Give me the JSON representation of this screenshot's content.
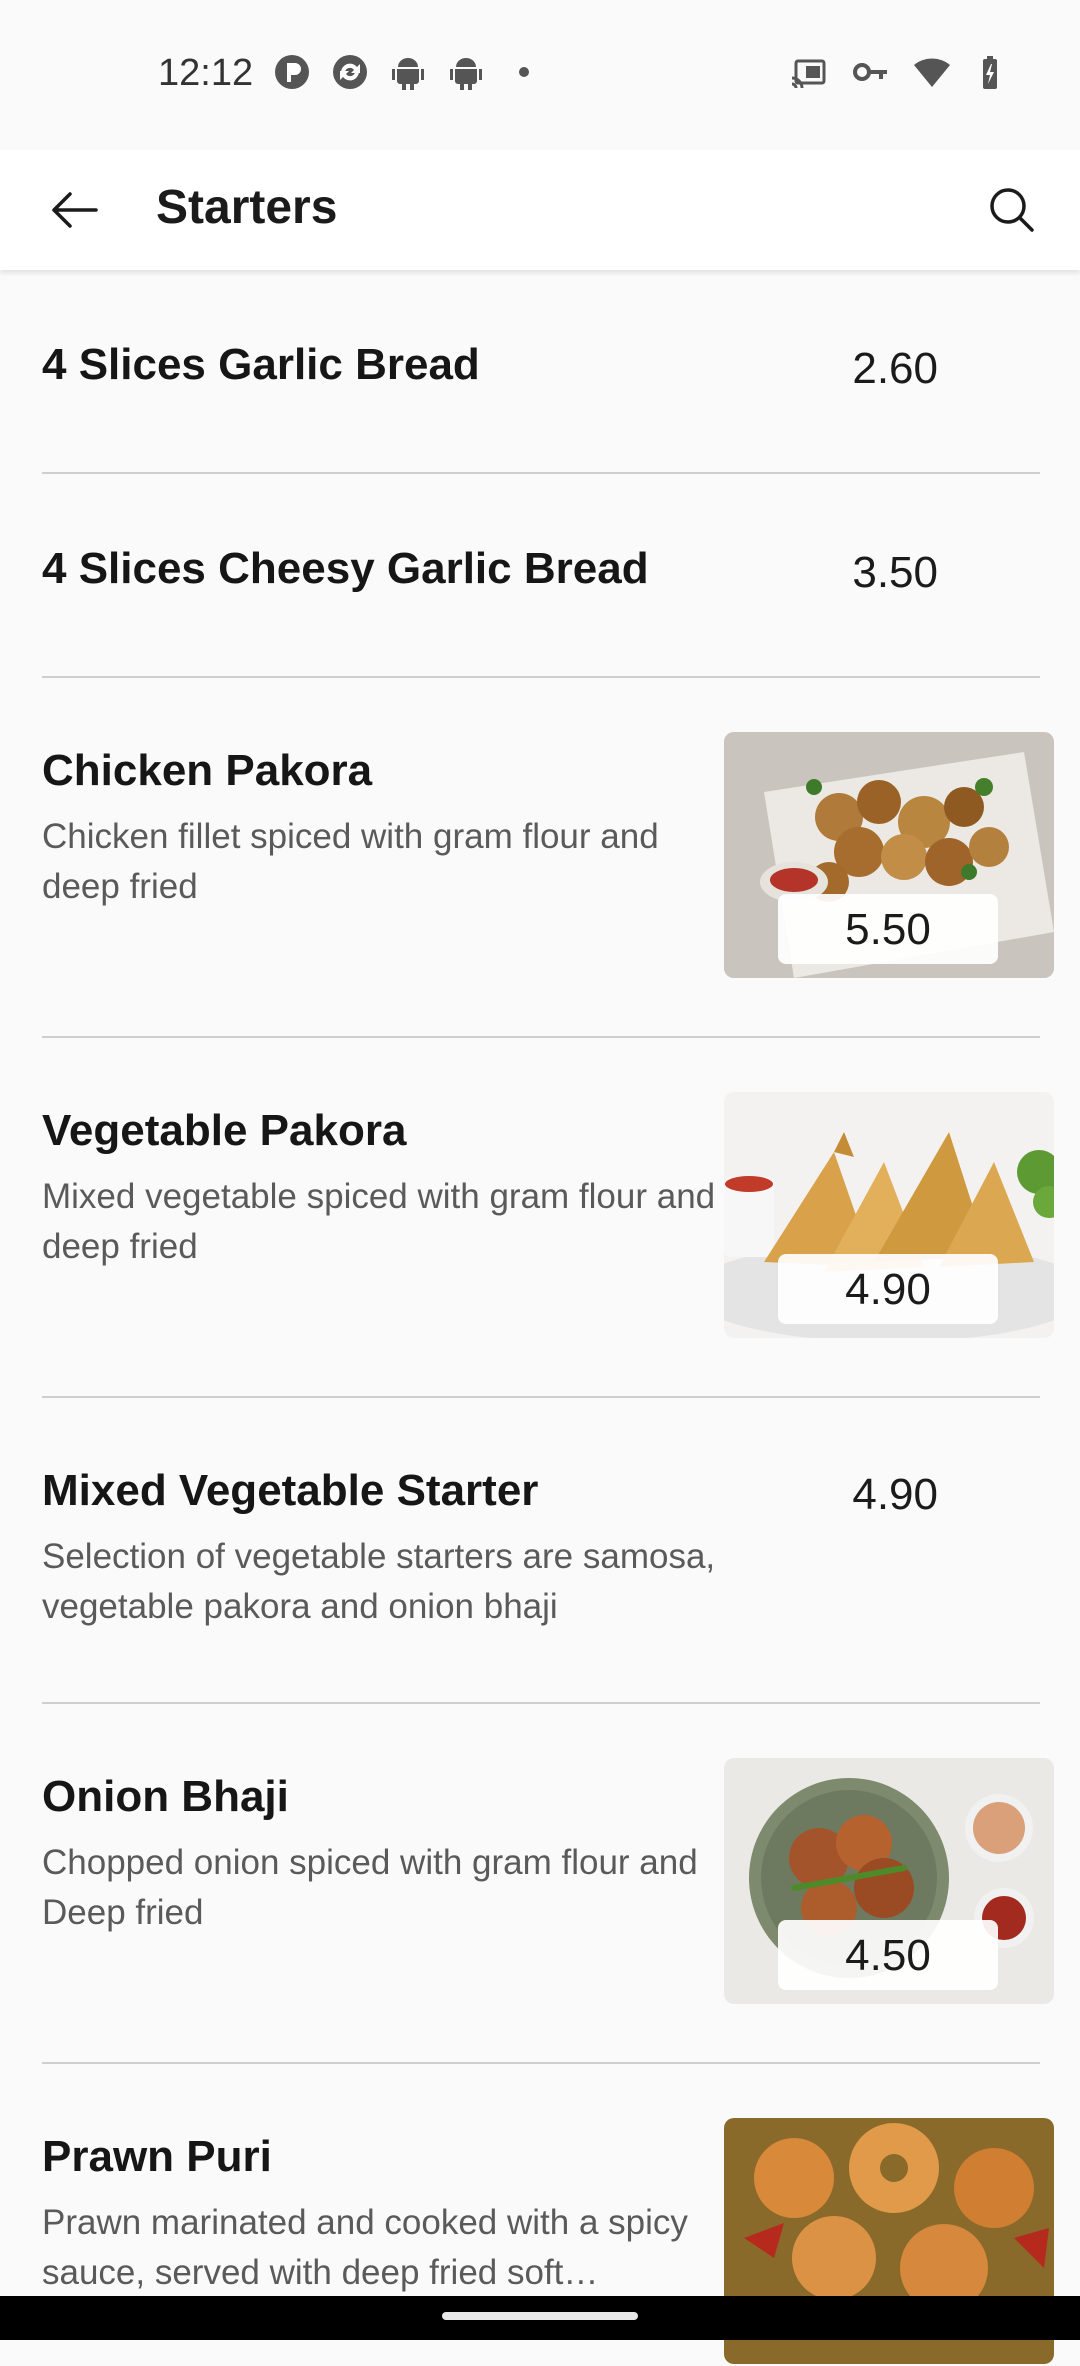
{
  "status_bar": {
    "time": "12:12",
    "left_icons": [
      "p-badge-icon",
      "sync-icon",
      "android-icon",
      "android-icon",
      "dot-icon"
    ],
    "right_icons": [
      "cast-icon",
      "vpn-key-icon",
      "wifi-icon",
      "battery-charging-icon"
    ]
  },
  "app_bar": {
    "title": "Starters",
    "back_icon": "arrow-left-icon",
    "search_icon": "search-icon"
  },
  "menu": {
    "items": [
      {
        "name": "4 Slices Garlic Bread",
        "description": "",
        "price": "2.60",
        "has_image": false
      },
      {
        "name": "4 Slices Cheesy Garlic Bread",
        "description": "",
        "price": "3.50",
        "has_image": false
      },
      {
        "name": "Chicken Pakora",
        "description": "Chicken fillet spiced with gram flour and deep fried",
        "price": "5.50",
        "has_image": true
      },
      {
        "name": "Vegetable Pakora",
        "description": "Mixed vegetable spiced with gram flour and deep fried",
        "price": "4.90",
        "has_image": true
      },
      {
        "name": "Mixed Vegetable Starter",
        "description": "Selection of vegetable starters are samosa, vegetable pakora and onion bhaji",
        "price": "4.90",
        "has_image": false
      },
      {
        "name": "Onion Bhaji",
        "description": "Chopped onion spiced with gram flour and Deep fried",
        "price": "4.50",
        "has_image": true
      },
      {
        "name": "Prawn Puri",
        "description": "Prawn marinated and cooked with a spicy sauce, served with deep fried soft…",
        "price": "",
        "has_image": true
      }
    ]
  },
  "colors": {
    "background": "#fbfafb",
    "divider": "#cfcfcf",
    "text_primary": "#161616",
    "text_secondary": "#5a5a5a"
  }
}
